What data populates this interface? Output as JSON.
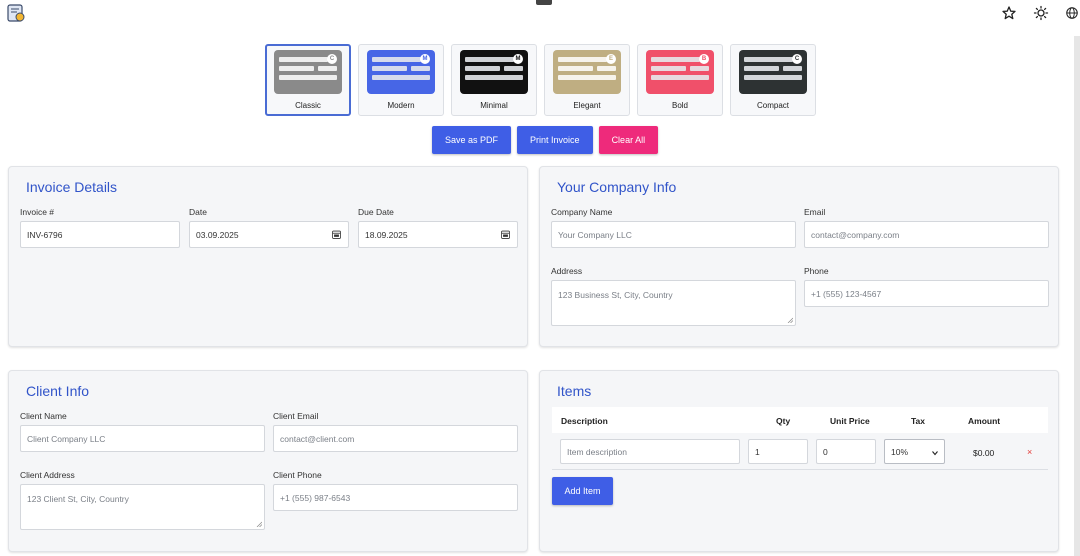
{
  "browser": {
    "icons": [
      "app-logo-icon",
      "star-icon",
      "theme-sun-icon",
      "language-globe-icon"
    ]
  },
  "templates": [
    {
      "label": "Classic",
      "badge": "C",
      "thumb_color": "#8a8a8a",
      "selected": true
    },
    {
      "label": "Modern",
      "badge": "M",
      "thumb_color": "#4766e6",
      "selected": false
    },
    {
      "label": "Minimal",
      "badge": "M",
      "thumb_color": "#111111",
      "selected": false
    },
    {
      "label": "Elegant",
      "badge": "E",
      "thumb_color": "#bfae82",
      "selected": false
    },
    {
      "label": "Bold",
      "badge": "B",
      "thumb_color": "#f0506a",
      "selected": false
    },
    {
      "label": "Compact",
      "badge": "C",
      "thumb_color": "#2d3233",
      "selected": false
    }
  ],
  "actions": {
    "save_pdf": "Save as PDF",
    "print": "Print Invoice",
    "clear": "Clear All"
  },
  "invoice_details": {
    "title": "Invoice Details",
    "number_label": "Invoice #",
    "number_value": "INV-6796",
    "date_label": "Date",
    "date_value": "03.09.2025",
    "due_label": "Due Date",
    "due_value": "18.09.2025"
  },
  "company": {
    "title": "Your Company Info",
    "name_label": "Company Name",
    "name_placeholder": "Your Company LLC",
    "email_label": "Email",
    "email_placeholder": "contact@company.com",
    "address_label": "Address",
    "address_placeholder": "123 Business St, City, Country",
    "phone_label": "Phone",
    "phone_placeholder": "+1 (555) 123-4567"
  },
  "client": {
    "title": "Client Info",
    "name_label": "Client Name",
    "name_placeholder": "Client Company LLC",
    "email_label": "Client Email",
    "email_placeholder": "contact@client.com",
    "address_label": "Client Address",
    "address_placeholder": "123 Client St, City, Country",
    "phone_label": "Client Phone",
    "phone_placeholder": "+1 (555) 987-6543"
  },
  "items": {
    "title": "Items",
    "columns": [
      "Description",
      "Qty",
      "Unit Price",
      "Tax",
      "Amount"
    ],
    "rows": [
      {
        "description_placeholder": "Item description",
        "qty": "1",
        "unit_price": "0",
        "tax": "10%",
        "amount": "$0.00",
        "remove": "×"
      }
    ],
    "add_label": "Add Item"
  }
}
